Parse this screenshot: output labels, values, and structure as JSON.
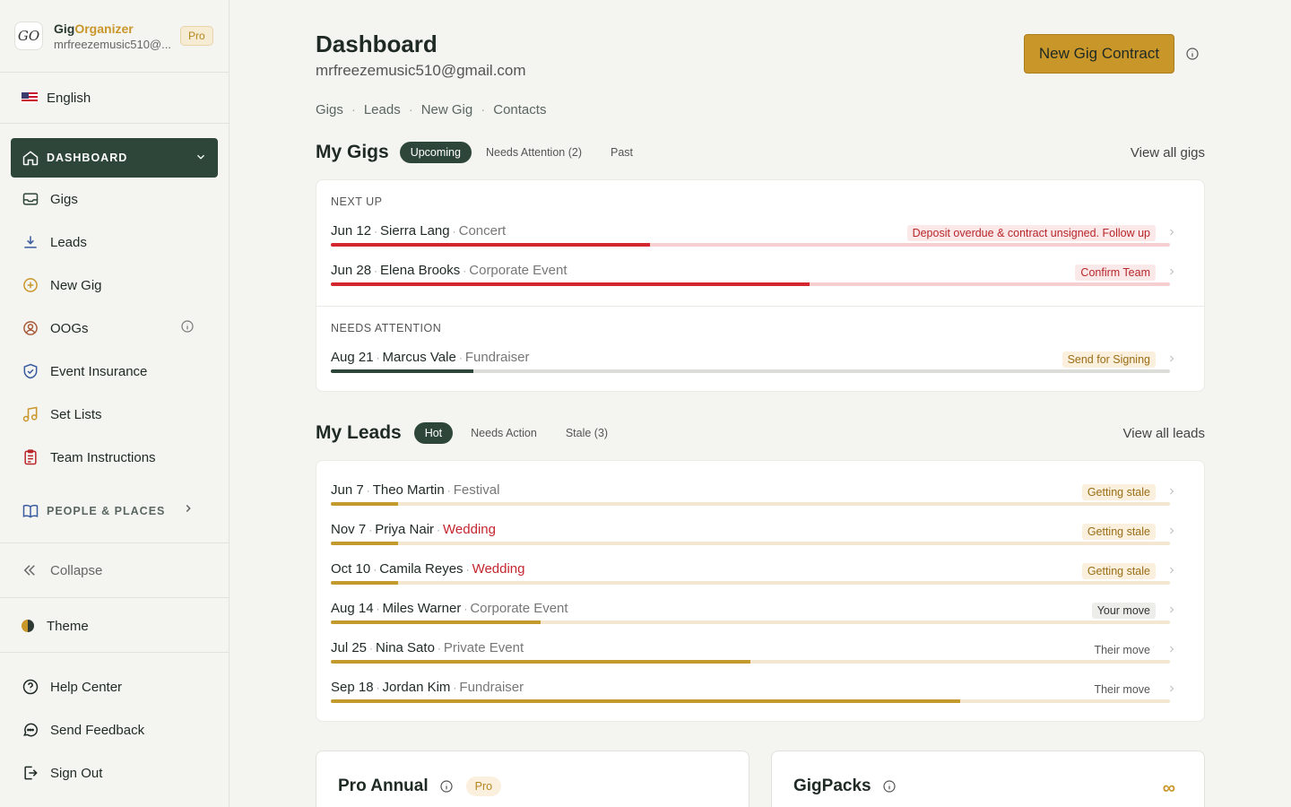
{
  "brand": {
    "name_part1": "Gig",
    "name_part2": "Organizer",
    "email": "mrfreezemusic510@...",
    "badge": "Pro",
    "logo_text": "GO"
  },
  "language": {
    "label": "English"
  },
  "sidebar": {
    "active": {
      "label": "DASHBOARD"
    },
    "items": [
      {
        "label": "Gigs",
        "icon": "inbox-icon"
      },
      {
        "label": "Leads",
        "icon": "download-icon"
      },
      {
        "label": "New Gig",
        "icon": "plus-circle-icon"
      },
      {
        "label": "OOGs",
        "icon": "user-circle-icon"
      },
      {
        "label": "Event Insurance",
        "icon": "shield-check-icon"
      },
      {
        "label": "Set Lists",
        "icon": "music-note-icon"
      },
      {
        "label": "Team Instructions",
        "icon": "clipboard-icon"
      }
    ],
    "section": {
      "label": "PEOPLE & PLACES"
    },
    "collapse": "Collapse",
    "theme": "Theme",
    "bottom": [
      {
        "label": "Help Center",
        "icon": "help-circle-icon"
      },
      {
        "label": "Send Feedback",
        "icon": "chat-bubble-icon"
      },
      {
        "label": "Sign Out",
        "icon": "sign-out-icon"
      }
    ]
  },
  "header": {
    "title": "Dashboard",
    "email": "mrfreezemusic510@gmail.com",
    "cta": "New Gig Contract"
  },
  "crumbs": [
    "Gigs",
    "Leads",
    "New Gig",
    "Contacts"
  ],
  "gigs": {
    "title": "My Gigs",
    "tabs": [
      "Upcoming",
      "Needs Attention (2)",
      "Past"
    ],
    "view_all": "View all gigs",
    "groups": [
      {
        "label": "NEXT UP",
        "rows": [
          {
            "date": "Jun 12",
            "name": "Sierra Lang",
            "type": "Concert",
            "status": "Deposit overdue & contract unsigned. Follow up",
            "progress": 0.38
          },
          {
            "date": "Jun 28",
            "name": "Elena Brooks",
            "type": "Corporate Event",
            "status": "Confirm Team",
            "progress": 0.57
          }
        ]
      },
      {
        "label": "NEEDS ATTENTION",
        "rows": [
          {
            "date": "Aug 21",
            "name": "Marcus Vale",
            "type": "Fundraiser",
            "status": "Send for Signing",
            "progress": 0.17
          }
        ]
      }
    ]
  },
  "leads": {
    "title": "My Leads",
    "tabs": [
      "Hot",
      "Needs Action",
      "Stale (3)"
    ],
    "view_all": "View all leads",
    "rows": [
      {
        "date": "Jun 7",
        "name": "Theo Martin",
        "type": "Festival",
        "status": "Getting stale",
        "progress": 0.08
      },
      {
        "date": "Nov 7",
        "name": "Priya Nair",
        "type": "Wedding",
        "status": "Getting stale",
        "progress": 0.08
      },
      {
        "date": "Oct 10",
        "name": "Camila Reyes",
        "type": "Wedding",
        "status": "Getting stale",
        "progress": 0.08
      },
      {
        "date": "Aug 14",
        "name": "Miles Warner",
        "type": "Corporate Event",
        "status": "Your move",
        "progress": 0.25
      },
      {
        "date": "Jul 25",
        "name": "Nina Sato",
        "type": "Private Event",
        "status": "Their move",
        "progress": 0.5
      },
      {
        "date": "Sep 18",
        "name": "Jordan Kim",
        "type": "Fundraiser",
        "status": "Their move",
        "progress": 0.75
      }
    ]
  },
  "cards": {
    "pro_annual": {
      "title": "Pro Annual",
      "badge": "Pro"
    },
    "gigpacks": {
      "title": "GigPacks",
      "value": "∞"
    }
  },
  "colors": {
    "primary": "#2d4639",
    "accent": "#c9962a",
    "alert": "#d3262e",
    "alert_track": "#f6cfd1",
    "lead_fill": "#c39a2c",
    "lead_track": "#f3e7d1",
    "neutral_fill": "#2d4639",
    "neutral_track": "#dcdcd8"
  }
}
